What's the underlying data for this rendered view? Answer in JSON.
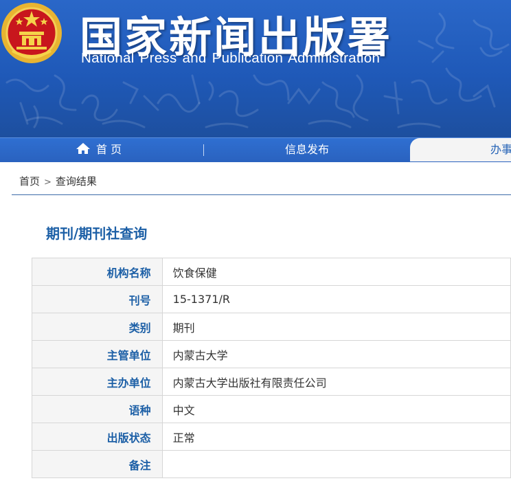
{
  "header": {
    "title_cn": "国家新闻出版署",
    "title_en": "National  Press and Publication Administration",
    "emblem_icon": "national-emblem-icon",
    "colors": {
      "header_blue": "#1f59b8",
      "nav_blue": "#2a62bf",
      "accent": "#1c5fa6"
    }
  },
  "nav": {
    "home_label": "首 页",
    "home_icon": "home-icon",
    "info_label": "信息发布",
    "right_label": "办事"
  },
  "breadcrumb": {
    "home": "首页",
    "separator": ">",
    "current": "查询结果"
  },
  "section": {
    "title": "期刊/期刊社查询"
  },
  "table": {
    "rows": [
      {
        "label": "机构名称",
        "value": "饮食保健"
      },
      {
        "label": "刊号",
        "value": "15-1371/R"
      },
      {
        "label": "类别",
        "value": "期刊"
      },
      {
        "label": "主管单位",
        "value": "内蒙古大学"
      },
      {
        "label": "主办单位",
        "value": "内蒙古大学出版社有限责任公司"
      },
      {
        "label": "语种",
        "value": "中文"
      },
      {
        "label": "出版状态",
        "value": "正常"
      },
      {
        "label": "备注",
        "value": ""
      }
    ]
  }
}
